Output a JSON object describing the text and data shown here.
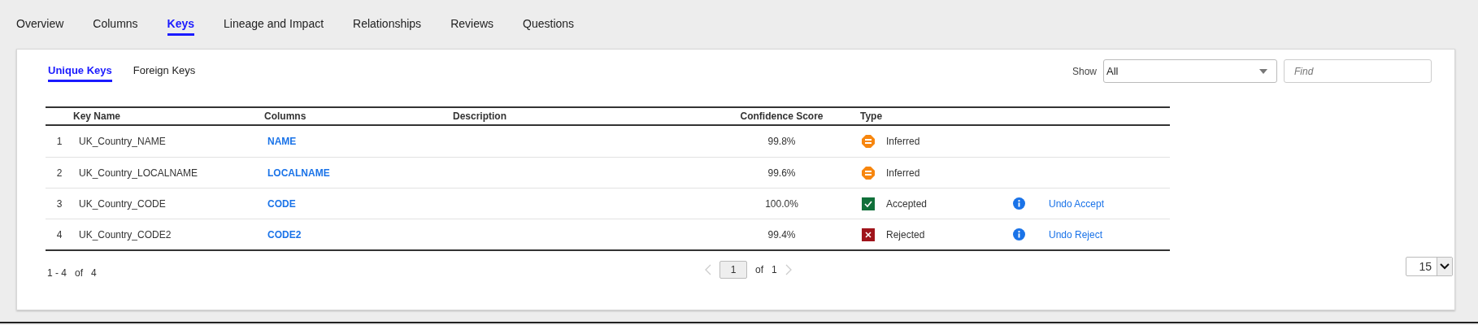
{
  "tabs": [
    {
      "label": "Overview",
      "selected": false
    },
    {
      "label": "Columns",
      "selected": false
    },
    {
      "label": "Keys",
      "selected": true
    },
    {
      "label": "Lineage and Impact",
      "selected": false
    },
    {
      "label": "Relationships",
      "selected": false
    },
    {
      "label": "Reviews",
      "selected": false
    },
    {
      "label": "Questions",
      "selected": false
    }
  ],
  "subtabs": [
    {
      "label": "Unique Keys",
      "selected": true
    },
    {
      "label": "Foreign Keys",
      "selected": false
    }
  ],
  "filter": {
    "label": "Show",
    "value": "All"
  },
  "search": {
    "placeholder": "Find"
  },
  "table": {
    "columns": [
      "Key Name",
      "Columns",
      "Description",
      "Confidence Score",
      "Type"
    ],
    "rows": [
      {
        "index": "1",
        "key_name": "UK_Country_NAME",
        "columns": "NAME",
        "score": "99.8%",
        "type": {
          "kind": "inferred",
          "label": "Inferred"
        }
      },
      {
        "index": "2",
        "key_name": "UK_Country_LOCALNAME",
        "columns": "LOCALNAME",
        "score": "99.6%",
        "type": {
          "kind": "inferred",
          "label": "Inferred"
        }
      },
      {
        "index": "3",
        "key_name": "UK_Country_CODE",
        "columns": "CODE",
        "score": "100.0%",
        "type": {
          "kind": "accepted",
          "label": "Accepted"
        },
        "action": "Undo Accept"
      },
      {
        "index": "4",
        "key_name": "UK_Country_CODE2",
        "columns": "CODE2",
        "score": "99.4%",
        "type": {
          "kind": "rejected",
          "label": "Rejected"
        },
        "action": "Undo Reject"
      }
    ]
  },
  "pagination": {
    "range": "1 - 4",
    "of_label": "of",
    "total": "4",
    "page": "1",
    "pages_label": "of",
    "pages": "1",
    "page_size": "15"
  }
}
